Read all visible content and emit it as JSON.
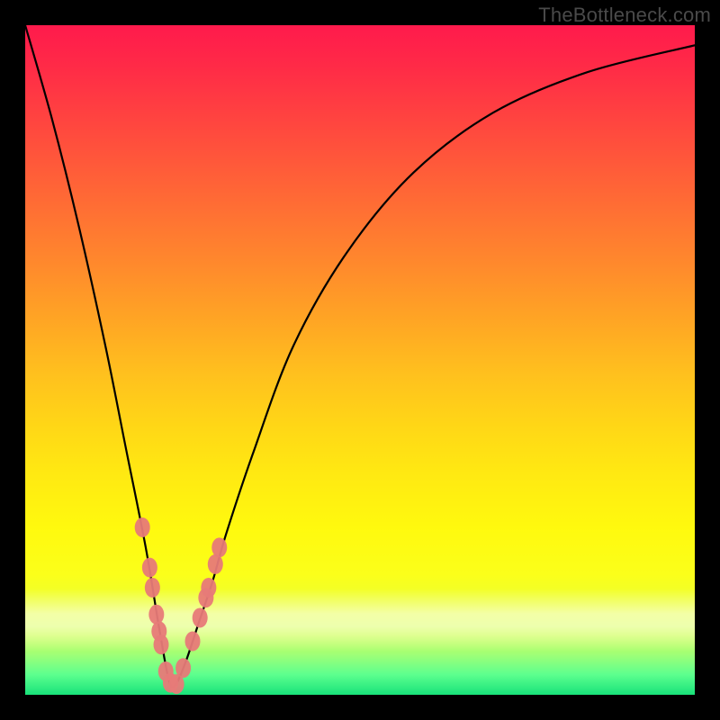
{
  "watermark": "TheBottleneck.com",
  "colors": {
    "frame": "#000000",
    "curve": "#000000",
    "marker": "#e77a78",
    "gradient_top": "#ff1a4c",
    "gradient_bottom": "#18e27a"
  },
  "chart_data": {
    "type": "line",
    "title": "",
    "xlabel": "",
    "ylabel": "",
    "xlim": [
      0,
      100
    ],
    "ylim": [
      0,
      100
    ],
    "notes": "Bottleneck-style V curve with minimum near x≈22; lower is better (green). No axis ticks or grid visible.",
    "series": [
      {
        "name": "curve",
        "x": [
          0,
          4,
          8,
          12,
          15,
          18,
          20,
          21.5,
          22.5,
          24,
          26,
          28,
          30,
          34,
          40,
          48,
          58,
          70,
          84,
          100
        ],
        "y": [
          100,
          86,
          70,
          52,
          37,
          22,
          10,
          2,
          1.6,
          5,
          11,
          17,
          24,
          36,
          52,
          66,
          78,
          87,
          93,
          97
        ]
      }
    ],
    "markers": {
      "name": "highlighted-points",
      "x": [
        17.5,
        18.6,
        19.0,
        19.6,
        20.0,
        20.3,
        21.0,
        21.7,
        22.6,
        23.6,
        25.0,
        26.1,
        27.0,
        27.4,
        28.4,
        29.0
      ],
      "y": [
        25.0,
        19.0,
        16.0,
        12.0,
        9.5,
        7.5,
        3.5,
        1.8,
        1.6,
        4.0,
        8.0,
        11.5,
        14.5,
        16.0,
        19.5,
        22.0
      ]
    }
  }
}
